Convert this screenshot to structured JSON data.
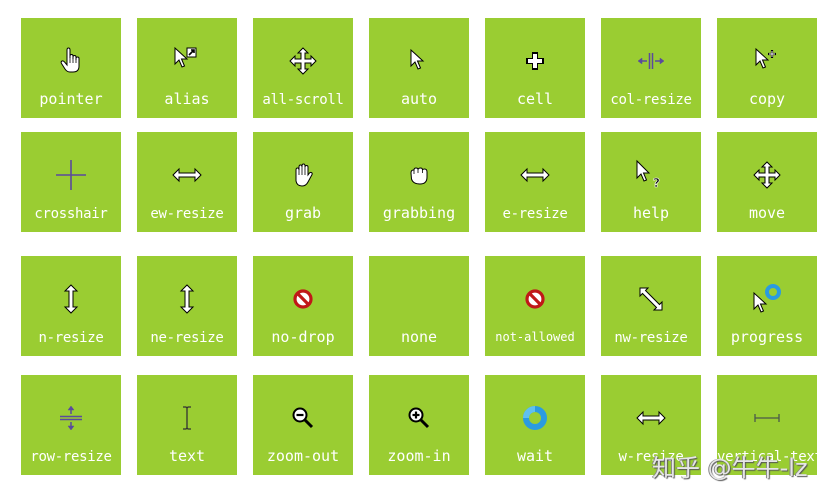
{
  "colors": {
    "tile_bg": "#9ACD32",
    "label": "#FFFFFF",
    "page_bg": "#FFFFFF",
    "accent_purple": "#5B4A9C",
    "no_drop_red": "#D42020",
    "wait_blue": "#2B9BE0"
  },
  "tiles": [
    {
      "label": "pointer",
      "icon": "hand-pointer-icon"
    },
    {
      "label": "alias",
      "icon": "arrow-alias-icon"
    },
    {
      "label": "all-scroll",
      "icon": "four-way-arrow-icon"
    },
    {
      "label": "auto",
      "icon": "arrow-cursor-icon"
    },
    {
      "label": "cell",
      "icon": "cell-plus-icon"
    },
    {
      "label": "col-resize",
      "icon": "col-resize-icon"
    },
    {
      "label": "copy",
      "icon": "arrow-copy-icon"
    },
    {
      "label": "crosshair",
      "icon": "crosshair-icon"
    },
    {
      "label": "ew-resize",
      "icon": "horizontal-double-arrow-icon"
    },
    {
      "label": "grab",
      "icon": "open-hand-icon"
    },
    {
      "label": "grabbing",
      "icon": "closed-hand-icon"
    },
    {
      "label": "e-resize",
      "icon": "horizontal-double-arrow-icon"
    },
    {
      "label": "help",
      "icon": "arrow-question-icon"
    },
    {
      "label": "move",
      "icon": "four-way-arrow-icon"
    },
    {
      "label": "n-resize",
      "icon": "vertical-double-arrow-icon"
    },
    {
      "label": "ne-resize",
      "icon": "vertical-double-arrow-icon"
    },
    {
      "label": "no-drop",
      "icon": "no-entry-icon"
    },
    {
      "label": "none",
      "icon": "none"
    },
    {
      "label": "not-allowed",
      "icon": "no-entry-icon"
    },
    {
      "label": "nw-resize",
      "icon": "diagonal-double-arrow-icon"
    },
    {
      "label": "progress",
      "icon": "arrow-busy-icon"
    },
    {
      "label": "row-resize",
      "icon": "row-resize-icon"
    },
    {
      "label": "text",
      "icon": "i-beam-icon"
    },
    {
      "label": "zoom-out",
      "icon": "magnifier-minus-icon"
    },
    {
      "label": "zoom-in",
      "icon": "magnifier-plus-icon"
    },
    {
      "label": "wait",
      "icon": "busy-ring-icon"
    },
    {
      "label": "w-resize",
      "icon": "horizontal-double-arrow-icon"
    },
    {
      "label": "vertical-text",
      "icon": "vertical-text-beam-icon"
    }
  ],
  "watermark": "知乎 @牛牛-lz"
}
